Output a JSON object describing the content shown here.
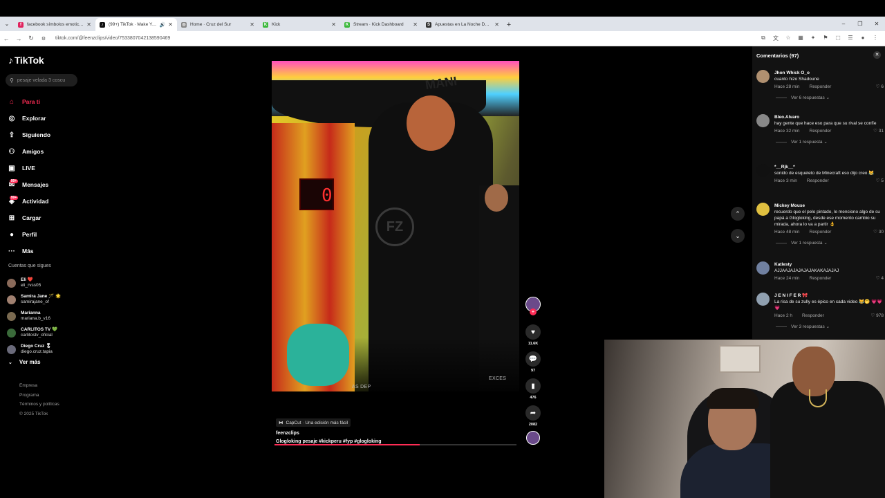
{
  "browser": {
    "tabs": [
      {
        "title": "facebook símbolos emoticone",
        "fav": "f",
        "color": "#e0245e",
        "active": false
      },
      {
        "title": "(99+) TikTok · Make Your D",
        "fav": "♪",
        "color": "#111111",
        "active": true
      },
      {
        "title": "Home · Cruz del Sur",
        "fav": "◎",
        "color": "#888888",
        "active": false
      },
      {
        "title": "Kick",
        "fav": "K",
        "color": "#3bb83b",
        "active": false
      },
      {
        "title": "Stream · Kick Dashboard",
        "fav": "K",
        "color": "#3bb83b",
        "active": false
      },
      {
        "title": "Apuestas en La Noche Dorada",
        "fav": "S",
        "color": "#333333",
        "active": false
      }
    ],
    "url": "tiktok.com/@feenzclips/video/7533807042138590469"
  },
  "sidebar": {
    "logo": "TikTok",
    "search_placeholder": "pesaje velada 3 coscu",
    "nav": [
      {
        "label": "Para ti",
        "icon": "home-icon",
        "glyph": "⌂",
        "active": true
      },
      {
        "label": "Explorar",
        "icon": "compass-icon",
        "glyph": "◎",
        "active": false
      },
      {
        "label": "Siguiendo",
        "icon": "following-icon",
        "glyph": "⇪",
        "active": false
      },
      {
        "label": "Amigos",
        "icon": "friends-icon",
        "glyph": "⚇",
        "active": false
      },
      {
        "label": "LIVE",
        "icon": "live-icon",
        "glyph": "▣",
        "active": false
      },
      {
        "label": "Mensajes",
        "icon": "messages-icon",
        "glyph": "✉",
        "active": false,
        "badge": "99+"
      },
      {
        "label": "Actividad",
        "icon": "activity-icon",
        "glyph": "◈",
        "active": false,
        "badge": "99+"
      },
      {
        "label": "Cargar",
        "icon": "upload-icon",
        "glyph": "⊞",
        "active": false
      },
      {
        "label": "Perfil",
        "icon": "profile-icon",
        "glyph": "●",
        "active": false
      },
      {
        "label": "Más",
        "icon": "more-icon",
        "glyph": "···",
        "active": false
      }
    ],
    "following_title": "Cuentas que sigues",
    "following": [
      {
        "name": "Eli ❤️",
        "handle": "eli_rvss05",
        "color": "#8a6a5a"
      },
      {
        "name": "Samira Jane 🪄 🌟",
        "handle": "samirajane_of",
        "color": "#a08070"
      },
      {
        "name": "Marianna",
        "handle": "mariana.b_v16",
        "color": "#7a6a50"
      },
      {
        "name": "CARLITOS TV 💚",
        "handle": "carlitostv_oficial",
        "color": "#3a6a3a"
      },
      {
        "name": "Diego Cruz 🎖",
        "handle": "diego.cruz.tapia",
        "color": "#6a6a7a"
      }
    ],
    "ver_mas": "Ver más",
    "footer": [
      "Empresa",
      "Programa",
      "Términos y políticas",
      "© 2025 TikTok"
    ]
  },
  "video": {
    "brand_text": "MANI",
    "digit": "0",
    "bottom_left_text": "AS DEP",
    "bottom_right_text": "EXCES",
    "fz_logo": "FZ",
    "likes": "11.6K",
    "comments": "97",
    "saves": "476",
    "shares": "2082",
    "capcut": "CapCut · Una edición más fácil",
    "author": "feenzclips",
    "description": "Glogloking pesaje #kickperu #fyp #glogloking",
    "progress": 0.6
  },
  "comments": {
    "title": "Comentarios (97)",
    "reply_label": "Responder",
    "items": [
      {
        "name": "Jhon Whick O_o",
        "text": "cuanto hizo Shadoune",
        "time": "Hace 28 min",
        "likes": "6",
        "replies": "Ver 6 respuestas ⌄",
        "color": "#b09070"
      },
      {
        "name": "Bleo.Alvaro",
        "text": "hay gente que hace eso para que su rival se confíe",
        "time": "Hace 32 min",
        "likes": "31",
        "replies": "Ver 1 respuesta ⌄",
        "color": "#888888"
      },
      {
        "name": "*__Rjk__*",
        "text": "sonido de esqueleto de Minecraft eso dijo creo 😹",
        "time": "Hace 3 min",
        "likes": "5",
        "replies": "",
        "color": "#111111"
      },
      {
        "name": "Mickey Mouse",
        "text": "recuerdo que el pelo pintado, le menciono algo de su papá a Glogloking, desde ese momento cambio su mirada, ahora lo va a partir 👌",
        "time": "Hace 48 min",
        "likes": "30",
        "replies": "Ver 1 respuesta ⌄",
        "color": "#e0c040"
      },
      {
        "name": "Katlesty",
        "text": "AJJAAJAJAJAJAJAKAKAJAJAJ",
        "time": "Hace 24 min",
        "likes": "4",
        "replies": "",
        "color": "#7080a0"
      },
      {
        "name": "J E N I F E R 🎀",
        "text": "La risa de su zully es épico en cada video 😹🤭 💗💗💗",
        "time": "Hace 2 h",
        "likes": "978",
        "replies": "Ver 3 respuestas ⌄",
        "color": "#90a0b0"
      }
    ]
  }
}
